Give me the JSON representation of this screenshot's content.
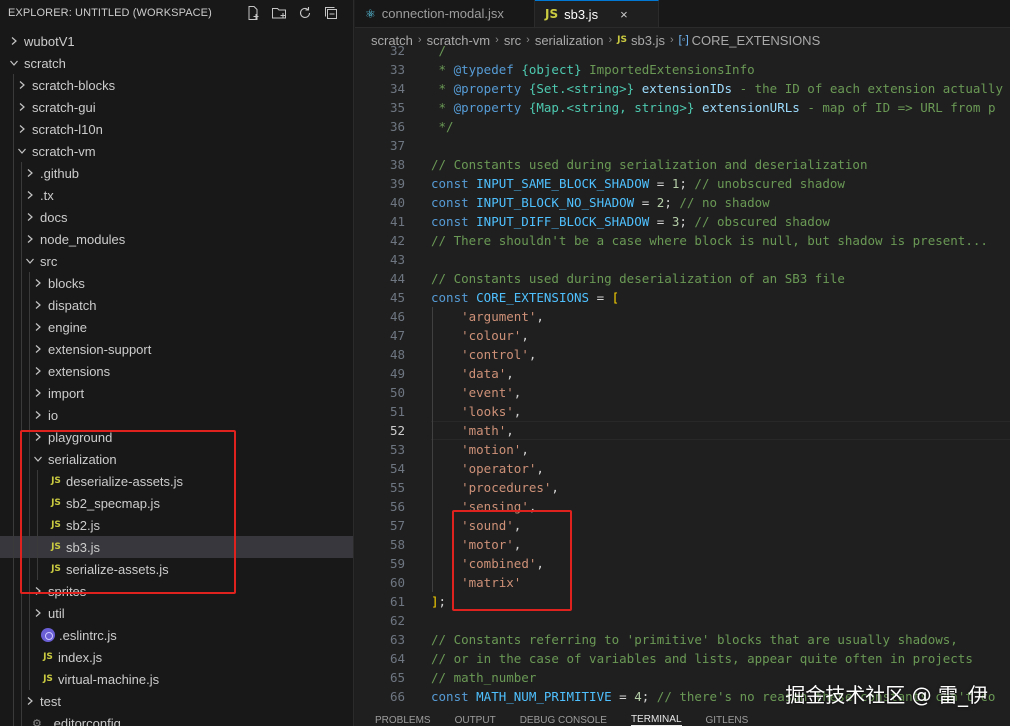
{
  "explorer": {
    "title": "EXPLORER: UNTITLED (WORKSPACE)",
    "actions": [
      "new-file-icon",
      "new-folder-icon",
      "refresh-icon",
      "collapse-all-icon"
    ]
  },
  "tree": [
    {
      "label": "wubotV1",
      "depth": 0,
      "type": "folder",
      "expanded": false
    },
    {
      "label": "scratch",
      "depth": 0,
      "type": "folder",
      "expanded": true
    },
    {
      "label": "scratch-blocks",
      "depth": 1,
      "type": "folder",
      "expanded": false
    },
    {
      "label": "scratch-gui",
      "depth": 1,
      "type": "folder",
      "expanded": false
    },
    {
      "label": "scratch-l10n",
      "depth": 1,
      "type": "folder",
      "expanded": false
    },
    {
      "label": "scratch-vm",
      "depth": 1,
      "type": "folder",
      "expanded": true
    },
    {
      "label": ".github",
      "depth": 2,
      "type": "folder",
      "expanded": false
    },
    {
      "label": ".tx",
      "depth": 2,
      "type": "folder",
      "expanded": false
    },
    {
      "label": "docs",
      "depth": 2,
      "type": "folder",
      "expanded": false
    },
    {
      "label": "node_modules",
      "depth": 2,
      "type": "folder",
      "expanded": false
    },
    {
      "label": "src",
      "depth": 2,
      "type": "folder",
      "expanded": true
    },
    {
      "label": "blocks",
      "depth": 3,
      "type": "folder",
      "expanded": false
    },
    {
      "label": "dispatch",
      "depth": 3,
      "type": "folder",
      "expanded": false
    },
    {
      "label": "engine",
      "depth": 3,
      "type": "folder",
      "expanded": false
    },
    {
      "label": "extension-support",
      "depth": 3,
      "type": "folder",
      "expanded": false
    },
    {
      "label": "extensions",
      "depth": 3,
      "type": "folder",
      "expanded": false
    },
    {
      "label": "import",
      "depth": 3,
      "type": "folder",
      "expanded": false
    },
    {
      "label": "io",
      "depth": 3,
      "type": "folder",
      "expanded": false
    },
    {
      "label": "playground",
      "depth": 3,
      "type": "folder",
      "expanded": false
    },
    {
      "label": "serialization",
      "depth": 3,
      "type": "folder",
      "expanded": true
    },
    {
      "label": "deserialize-assets.js",
      "depth": 4,
      "type": "js"
    },
    {
      "label": "sb2_specmap.js",
      "depth": 4,
      "type": "js"
    },
    {
      "label": "sb2.js",
      "depth": 4,
      "type": "js"
    },
    {
      "label": "sb3.js",
      "depth": 4,
      "type": "js",
      "selected": true
    },
    {
      "label": "serialize-assets.js",
      "depth": 4,
      "type": "js"
    },
    {
      "label": "sprites",
      "depth": 3,
      "type": "folder",
      "expanded": false
    },
    {
      "label": "util",
      "depth": 3,
      "type": "folder",
      "expanded": false
    },
    {
      "label": ".eslintrc.js",
      "depth": 3,
      "type": "eslint"
    },
    {
      "label": "index.js",
      "depth": 3,
      "type": "js"
    },
    {
      "label": "virtual-machine.js",
      "depth": 3,
      "type": "js"
    },
    {
      "label": "test",
      "depth": 2,
      "type": "folder",
      "expanded": false
    },
    {
      "label": ".editorconfig",
      "depth": 2,
      "type": "gear"
    }
  ],
  "tabs": [
    {
      "label": "connection-modal.jsx",
      "icon": "react-icon",
      "active": false
    },
    {
      "label": "sb3.js",
      "icon": "JS",
      "active": true,
      "close": "×"
    }
  ],
  "breadcrumb": {
    "parts": [
      "scratch",
      "scratch-vm",
      "src",
      "serialization",
      "sb3.js",
      "CORE_EXTENSIONS"
    ],
    "file_icon": "JS",
    "symbol_icon": "[◦]"
  },
  "code": {
    "current_line": 52,
    "lines": [
      {
        "n": "32",
        "tokens": [
          [
            "c",
            " /"
          ]
        ]
      },
      {
        "n": "33",
        "tokens": [
          [
            "c",
            " * "
          ],
          [
            "doc",
            "@typedef"
          ],
          [
            "c",
            " "
          ],
          [
            "y",
            "{object}"
          ],
          [
            "c",
            " ImportedExtensionsInfo"
          ]
        ]
      },
      {
        "n": "34",
        "tokens": [
          [
            "c",
            " * "
          ],
          [
            "doc",
            "@property"
          ],
          [
            "c",
            " "
          ],
          [
            "y",
            "{Set.<string>}"
          ],
          [
            "c",
            " "
          ],
          [
            "docv",
            "extensionIDs"
          ],
          [
            "c",
            " - the ID of each extension actually"
          ]
        ]
      },
      {
        "n": "35",
        "tokens": [
          [
            "c",
            " * "
          ],
          [
            "doc",
            "@property"
          ],
          [
            "c",
            " "
          ],
          [
            "y",
            "{Map.<string, string>}"
          ],
          [
            "c",
            " "
          ],
          [
            "docv",
            "extensionURLs"
          ],
          [
            "c",
            " - map of ID => URL from p"
          ]
        ]
      },
      {
        "n": "36",
        "tokens": [
          [
            "c",
            " */"
          ]
        ]
      },
      {
        "n": "37",
        "tokens": []
      },
      {
        "n": "38",
        "tokens": [
          [
            "c",
            "// Constants used during serialization and deserialization"
          ]
        ]
      },
      {
        "n": "39",
        "tokens": [
          [
            "k",
            "const "
          ],
          [
            "v",
            "INPUT_SAME_BLOCK_SHADOW"
          ],
          [
            "p",
            " = "
          ],
          [
            "n",
            "1"
          ],
          [
            "p",
            "; "
          ],
          [
            "c",
            "// unobscured shadow"
          ]
        ]
      },
      {
        "n": "40",
        "tokens": [
          [
            "k",
            "const "
          ],
          [
            "v",
            "INPUT_BLOCK_NO_SHADOW"
          ],
          [
            "p",
            " = "
          ],
          [
            "n",
            "2"
          ],
          [
            "p",
            "; "
          ],
          [
            "c",
            "// no shadow"
          ]
        ]
      },
      {
        "n": "41",
        "tokens": [
          [
            "k",
            "const "
          ],
          [
            "v",
            "INPUT_DIFF_BLOCK_SHADOW"
          ],
          [
            "p",
            " = "
          ],
          [
            "n",
            "3"
          ],
          [
            "p",
            "; "
          ],
          [
            "c",
            "// obscured shadow"
          ]
        ]
      },
      {
        "n": "42",
        "tokens": [
          [
            "c",
            "// There shouldn't be a case where block is null, but shadow is present..."
          ]
        ]
      },
      {
        "n": "43",
        "tokens": []
      },
      {
        "n": "44",
        "tokens": [
          [
            "c",
            "// Constants used during deserialization of an SB3 file"
          ]
        ]
      },
      {
        "n": "45",
        "tokens": [
          [
            "k",
            "const "
          ],
          [
            "v",
            "CORE_EXTENSIONS"
          ],
          [
            "p",
            " = "
          ],
          [
            "b",
            "["
          ]
        ]
      },
      {
        "n": "46",
        "tokens": [
          [
            "p",
            "    "
          ],
          [
            "s",
            "'argument'"
          ],
          [
            "p",
            ","
          ]
        ]
      },
      {
        "n": "47",
        "tokens": [
          [
            "p",
            "    "
          ],
          [
            "s",
            "'colour'"
          ],
          [
            "p",
            ","
          ]
        ]
      },
      {
        "n": "48",
        "tokens": [
          [
            "p",
            "    "
          ],
          [
            "s",
            "'control'"
          ],
          [
            "p",
            ","
          ]
        ]
      },
      {
        "n": "49",
        "tokens": [
          [
            "p",
            "    "
          ],
          [
            "s",
            "'data'"
          ],
          [
            "p",
            ","
          ]
        ]
      },
      {
        "n": "50",
        "tokens": [
          [
            "p",
            "    "
          ],
          [
            "s",
            "'event'"
          ],
          [
            "p",
            ","
          ]
        ]
      },
      {
        "n": "51",
        "tokens": [
          [
            "p",
            "    "
          ],
          [
            "s",
            "'looks'"
          ],
          [
            "p",
            ","
          ]
        ]
      },
      {
        "n": "52",
        "tokens": [
          [
            "p",
            "    "
          ],
          [
            "s",
            "'math'"
          ],
          [
            "p",
            ","
          ]
        ]
      },
      {
        "n": "53",
        "tokens": [
          [
            "p",
            "    "
          ],
          [
            "s",
            "'motion'"
          ],
          [
            "p",
            ","
          ]
        ]
      },
      {
        "n": "54",
        "tokens": [
          [
            "p",
            "    "
          ],
          [
            "s",
            "'operator'"
          ],
          [
            "p",
            ","
          ]
        ]
      },
      {
        "n": "55",
        "tokens": [
          [
            "p",
            "    "
          ],
          [
            "s",
            "'procedures'"
          ],
          [
            "p",
            ","
          ]
        ]
      },
      {
        "n": "56",
        "tokens": [
          [
            "p",
            "    "
          ],
          [
            "s",
            "'sensing'"
          ],
          [
            "p",
            ","
          ]
        ]
      },
      {
        "n": "57",
        "tokens": [
          [
            "p",
            "    "
          ],
          [
            "s",
            "'sound'"
          ],
          [
            "p",
            ","
          ]
        ]
      },
      {
        "n": "58",
        "tokens": [
          [
            "p",
            "    "
          ],
          [
            "s",
            "'motor'"
          ],
          [
            "p",
            ","
          ]
        ]
      },
      {
        "n": "59",
        "tokens": [
          [
            "p",
            "    "
          ],
          [
            "s",
            "'combined'"
          ],
          [
            "p",
            ","
          ]
        ]
      },
      {
        "n": "60",
        "tokens": [
          [
            "p",
            "    "
          ],
          [
            "s",
            "'matrix'"
          ]
        ]
      },
      {
        "n": "61",
        "tokens": [
          [
            "b",
            "]"
          ],
          [
            "p",
            ";"
          ]
        ]
      },
      {
        "n": "62",
        "tokens": []
      },
      {
        "n": "63",
        "tokens": [
          [
            "c",
            "// Constants referring to 'primitive' blocks that are usually shadows,"
          ]
        ]
      },
      {
        "n": "64",
        "tokens": [
          [
            "c",
            "// or in the case of variables and lists, appear quite often in projects"
          ]
        ]
      },
      {
        "n": "65",
        "tokens": [
          [
            "c",
            "// math_number"
          ]
        ]
      },
      {
        "n": "66",
        "tokens": [
          [
            "k",
            "const "
          ],
          [
            "v",
            "MATH_NUM_PRIMITIVE"
          ],
          [
            "p",
            " = "
          ],
          [
            "n",
            "4"
          ],
          [
            "p",
            "; "
          ],
          [
            "c",
            "// there's no reason these constants can't co"
          ]
        ]
      }
    ]
  },
  "panel_tabs": [
    "PROBLEMS",
    "OUTPUT",
    "DEBUG CONSOLE",
    "TERMINAL",
    "GITLENS"
  ],
  "active_panel_tab": "TERMINAL",
  "watermark": "掘金技术社区 @ 雷_伊",
  "colors": {
    "annotation_red": "#e0221e",
    "selection": "#37373d",
    "accent": "#0078d4"
  }
}
